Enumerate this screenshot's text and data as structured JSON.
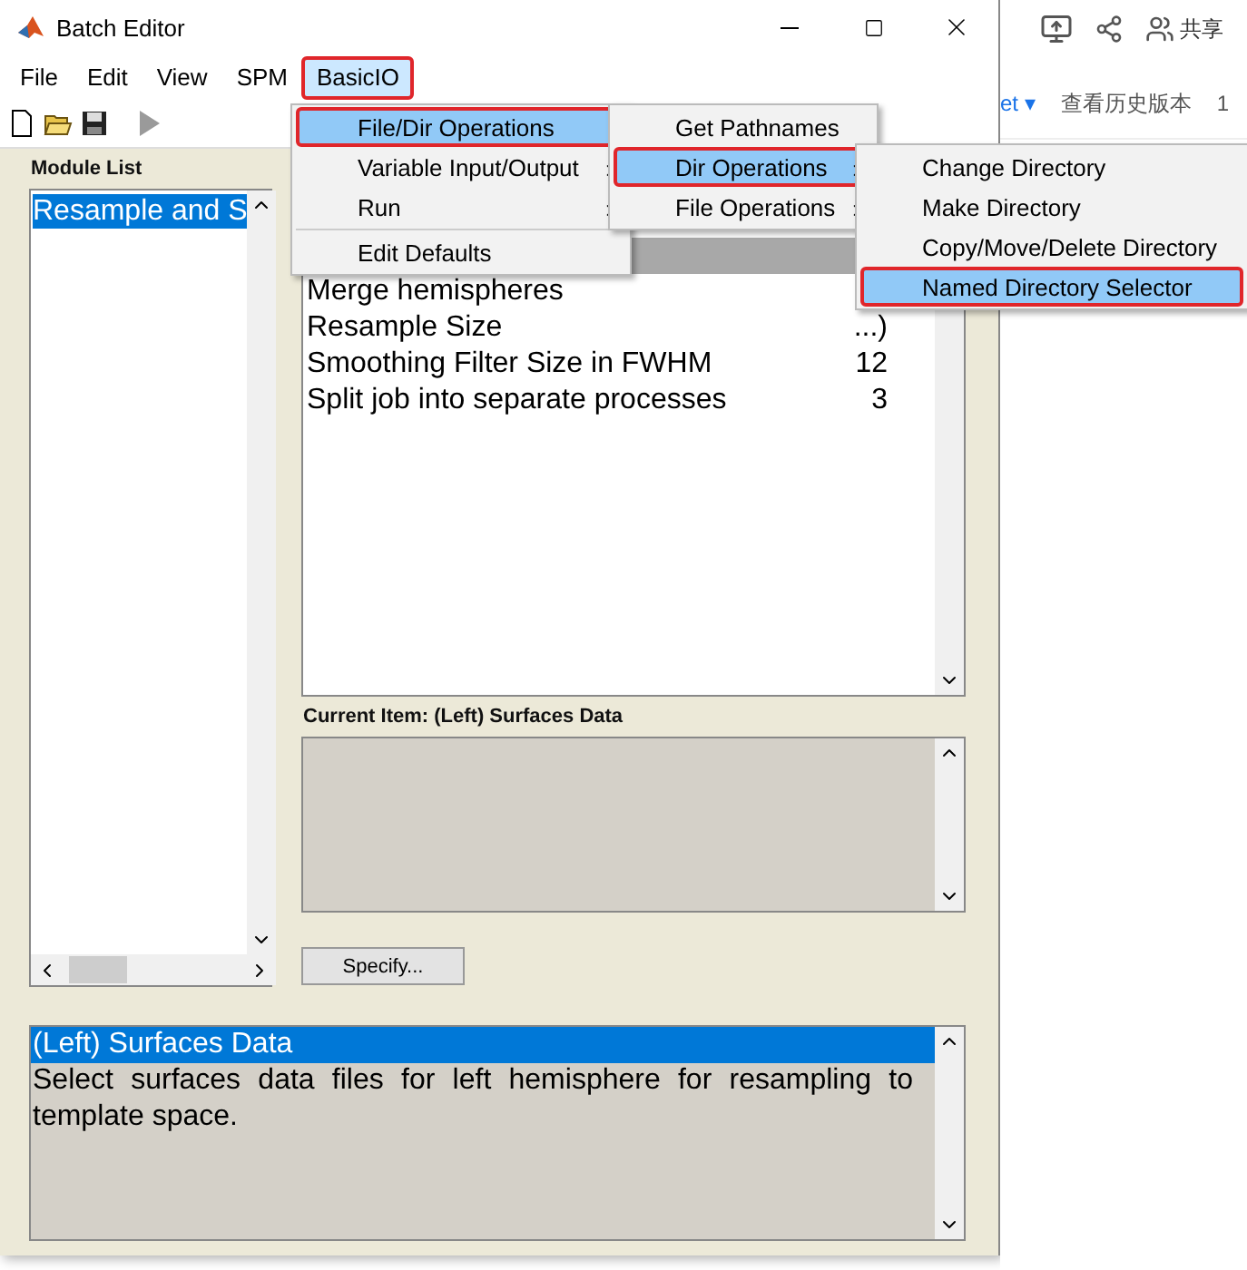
{
  "window": {
    "title": "Batch Editor"
  },
  "menubar": [
    {
      "label": "File",
      "selected": false,
      "outlined": false
    },
    {
      "label": "Edit",
      "selected": false,
      "outlined": false
    },
    {
      "label": "View",
      "selected": false,
      "outlined": false
    },
    {
      "label": "SPM",
      "selected": false,
      "outlined": false
    },
    {
      "label": "BasicIO",
      "selected": true,
      "outlined": true
    }
  ],
  "menus": [
    {
      "items": [
        {
          "label": "File/Dir Operations",
          "submenu": false,
          "selected": true,
          "outlined": true
        },
        {
          "label": "Variable Input/Output",
          "submenu": true,
          "selected": false,
          "outlined": false
        },
        {
          "label": "Run",
          "submenu": true,
          "selected": false,
          "outlined": false
        },
        {
          "kind": "separator"
        },
        {
          "label": "Edit Defaults",
          "submenu": false,
          "selected": false,
          "outlined": false
        }
      ]
    },
    {
      "items": [
        {
          "label": "Get Pathnames",
          "submenu": false,
          "selected": false,
          "outlined": false
        },
        {
          "label": "Dir Operations",
          "submenu": true,
          "selected": true,
          "outlined": true
        },
        {
          "label": "File Operations",
          "submenu": true,
          "selected": false,
          "outlined": false
        }
      ]
    },
    {
      "items": [
        {
          "label": "Change Directory",
          "submenu": false,
          "selected": false,
          "outlined": false
        },
        {
          "label": "Make Directory",
          "submenu": false,
          "selected": false,
          "outlined": false
        },
        {
          "label": "Copy/Move/Delete Directory",
          "submenu": false,
          "selected": false,
          "outlined": false
        },
        {
          "label": "Named Directory Selector",
          "submenu": false,
          "selected": true,
          "outlined": true
        }
      ]
    }
  ],
  "module_list": {
    "title": "Module List",
    "items": [
      {
        "label": "Resample and S",
        "selected": true
      }
    ]
  },
  "items_list": {
    "rows": [
      {
        "label": "Merge hemispheres",
        "value": ""
      },
      {
        "label": "Resample Size",
        "value": "...)"
      },
      {
        "label": "Smoothing Filter Size in FWHM",
        "value": "12"
      },
      {
        "label": "Split job into separate processes",
        "value": "3"
      }
    ]
  },
  "current_item": {
    "label": "Current Item: (Left) Surfaces Data"
  },
  "specify_button": "Specify...",
  "help": {
    "heading": "(Left) Surfaces Data",
    "text": "Select surfaces data files for left hemisphere for resampling to template space."
  },
  "web": {
    "share": "共享",
    "tab": "et ▾",
    "history": "查看历史版本",
    "extra": "1"
  }
}
